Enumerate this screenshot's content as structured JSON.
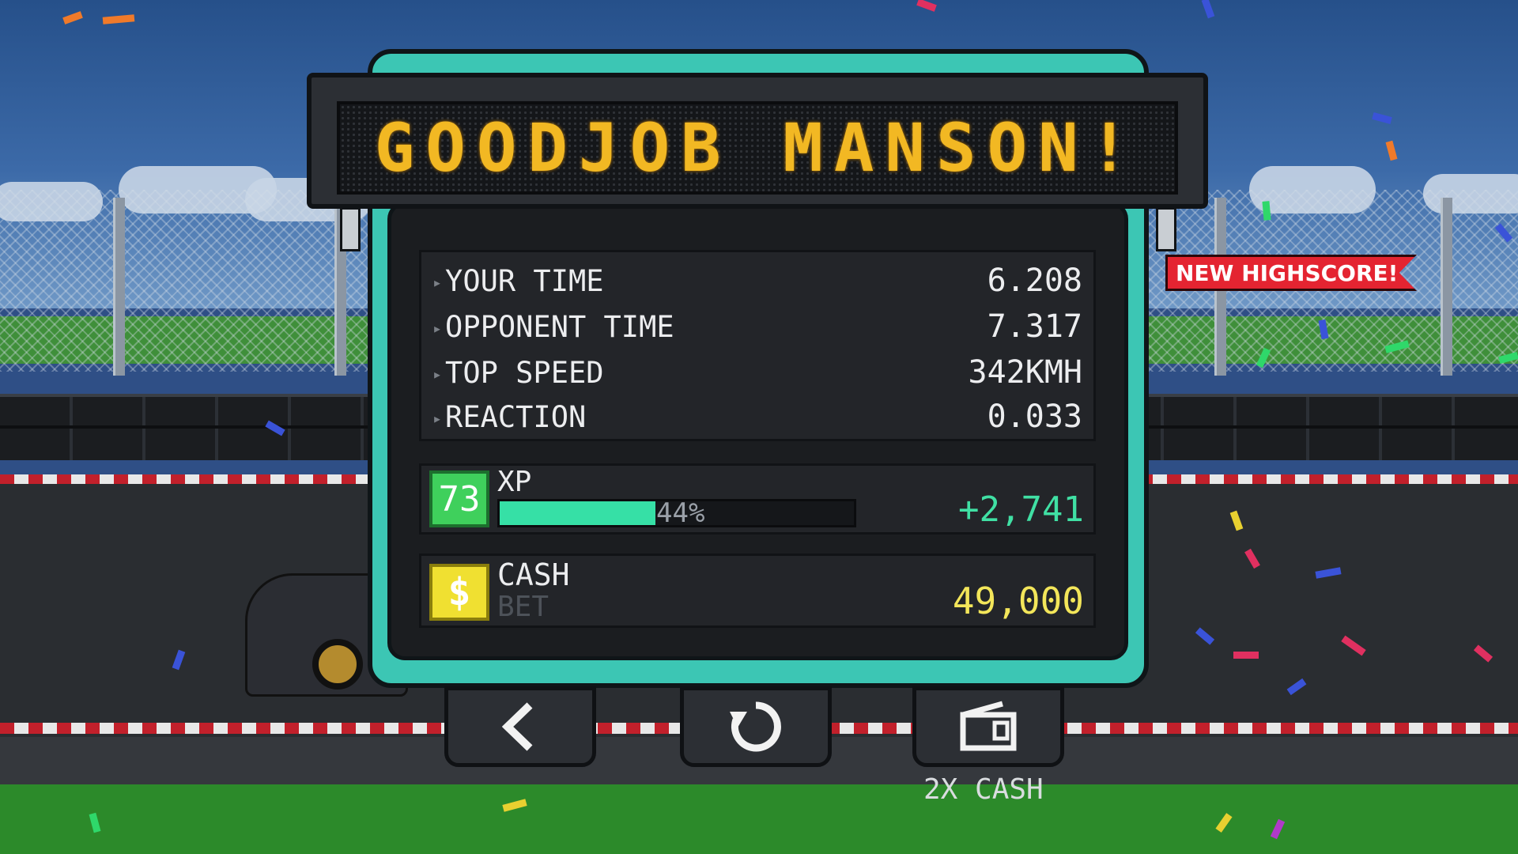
{
  "banner": {
    "title": "GOODJOB MANSON!"
  },
  "stats": [
    {
      "label": "YOUR TIME",
      "value": "6.208"
    },
    {
      "label": "OPPONENT TIME",
      "value": "7.317"
    },
    {
      "label": "TOP SPEED",
      "value": "342KMH"
    },
    {
      "label": "REACTION",
      "value": "0.033"
    }
  ],
  "xp": {
    "level": "73",
    "label": "XP",
    "progress_percent": 44,
    "progress_text": "44%",
    "gained": "+2,741"
  },
  "cash": {
    "label": "CASH",
    "sublabel": "BET",
    "amount": "49,000",
    "icon_symbol": "$"
  },
  "highscore_badge": "NEW HIGHSCORE!",
  "buttons": {
    "back": {
      "icon": "chevron-left-icon"
    },
    "retry": {
      "icon": "restart-icon"
    },
    "double_cash": {
      "icon": "video-camera-icon",
      "label": "2X CASH"
    }
  },
  "colors": {
    "panel_teal": "#3cc6b4",
    "banner_text": "#f2b823",
    "xp_green": "#40e0a4",
    "cash_yellow": "#f3e65a",
    "ribbon_red": "#e42431"
  }
}
